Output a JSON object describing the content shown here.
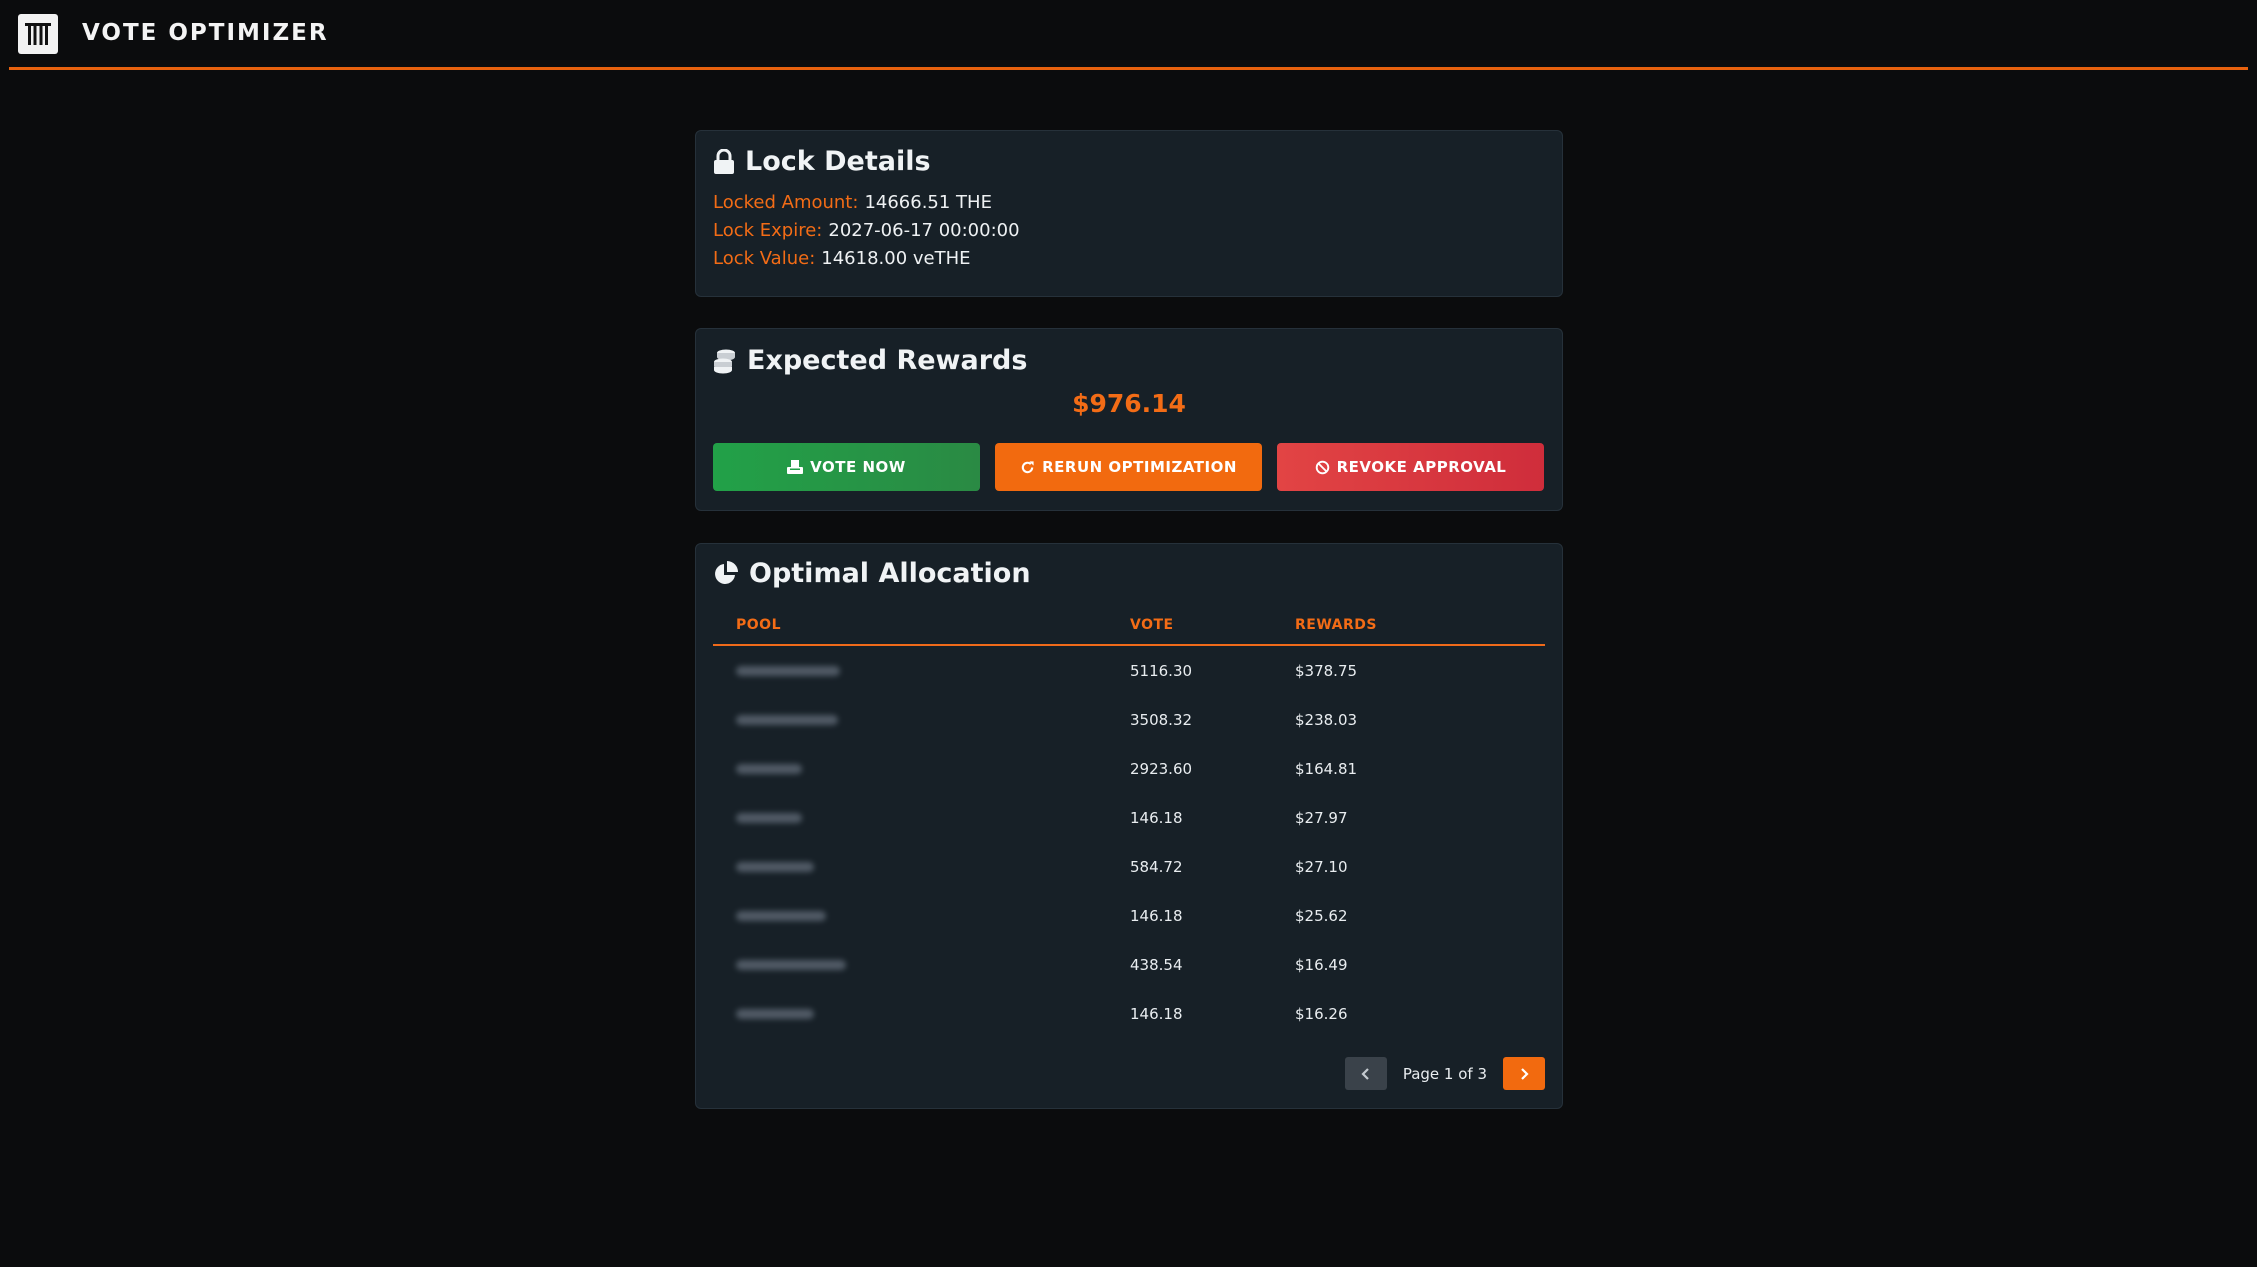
{
  "app": {
    "title": "VOTE OPTIMIZER"
  },
  "colors": {
    "accent": "#f36c16",
    "background": "#0b0c0d",
    "card": "#172027",
    "vote_green": "#22a148",
    "revoke_red": "#e24444"
  },
  "lock_details": {
    "title": "Lock Details",
    "icon": "lock-icon",
    "fields": [
      {
        "label": "Locked Amount:",
        "value": "14666.51 THE"
      },
      {
        "label": "Lock Expire:",
        "value": "2027-06-17 00:00:00"
      },
      {
        "label": "Lock Value:",
        "value": "14618.00 veTHE"
      }
    ]
  },
  "expected_rewards": {
    "title": "Expected Rewards",
    "icon": "coins-icon",
    "amount": "$976.14",
    "buttons": {
      "vote": "VOTE NOW",
      "rerun": "RERUN OPTIMIZATION",
      "revoke": "REVOKE APPROVAL"
    }
  },
  "allocation": {
    "title": "Optimal Allocation",
    "icon": "pie-chart-icon",
    "columns": [
      "POOL",
      "VOTE",
      "REWARDS"
    ],
    "rows": [
      {
        "vote": "5116.30",
        "rewards": "$378.75"
      },
      {
        "vote": "3508.32",
        "rewards": "$238.03"
      },
      {
        "vote": "2923.60",
        "rewards": "$164.81"
      },
      {
        "vote": "146.18",
        "rewards": "$27.97"
      },
      {
        "vote": "584.72",
        "rewards": "$27.10"
      },
      {
        "vote": "146.18",
        "rewards": "$25.62"
      },
      {
        "vote": "438.54",
        "rewards": "$16.49"
      },
      {
        "vote": "146.18",
        "rewards": "$16.26"
      }
    ],
    "pagination": {
      "text": "Page 1 of 3",
      "current": 1,
      "total": 3
    }
  }
}
